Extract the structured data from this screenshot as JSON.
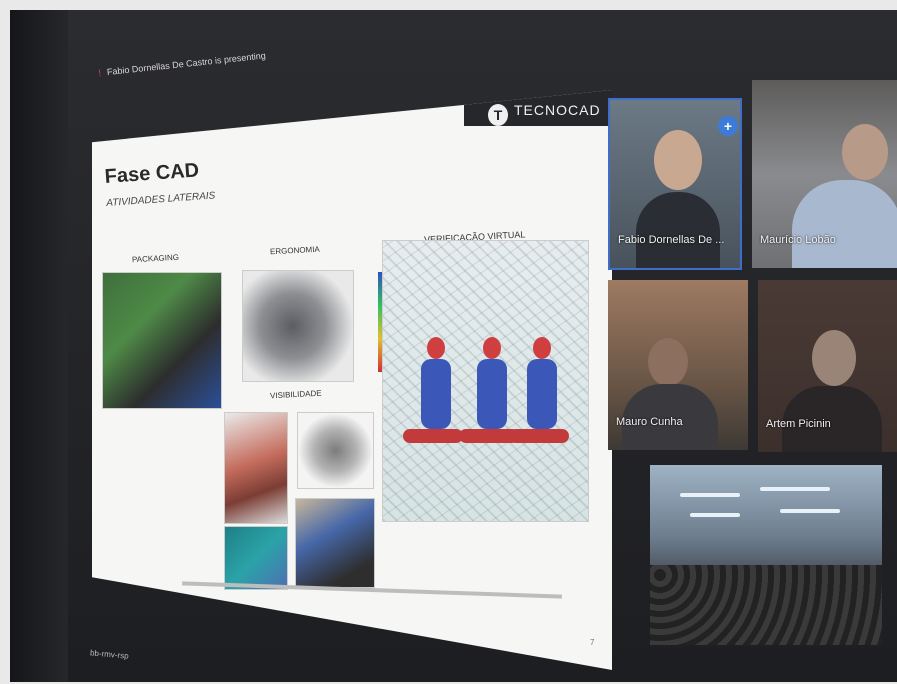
{
  "meeting": {
    "presenting_text": "Fabio Dornellas De Castro is presenting",
    "bottom_text": "bb-rmv-rsp"
  },
  "slide": {
    "logo_text": "TECNOCAD",
    "logo_letter": "T",
    "title": "Fase CAD",
    "subtitle": "ATIVIDADES LATERAIS",
    "labels": {
      "packaging": "PACKAGING",
      "ergonomia": "ERGONOMIA",
      "visibilidade": "VISIBILIDADE",
      "verificacao": "VERIFICAÇÃO VIRTUAL"
    },
    "page_number": "7"
  },
  "participants": [
    {
      "name": "Fabio Dornellas De ..."
    },
    {
      "name": "Maurício Lobão"
    },
    {
      "name": "Mauro Cunha"
    },
    {
      "name": "Artem Picinin"
    },
    {
      "name": ""
    }
  ],
  "icons": {
    "pin_badge": "plus-icon"
  }
}
